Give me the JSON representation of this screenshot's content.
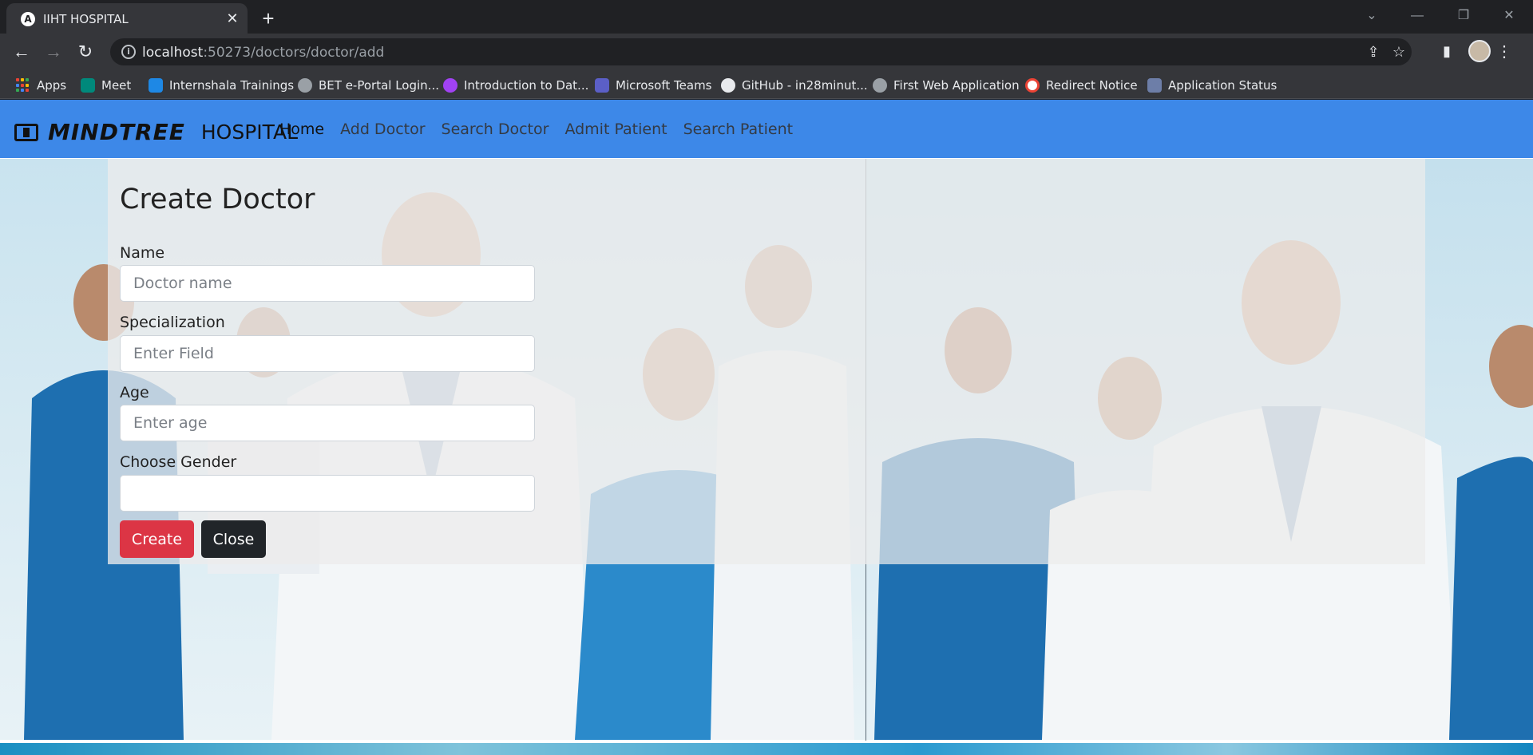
{
  "browser": {
    "tab_title": "IIHT HOSPITAL",
    "tab_favicon_letter": "A",
    "url_host": "localhost",
    "url_path": ":50273/doctors/doctor/add",
    "bookmarks": [
      {
        "label": "Apps",
        "color": "#4285f4"
      },
      {
        "label": "Meet",
        "color": "#00897b"
      },
      {
        "label": "Internshala Trainings",
        "color": "#1e88e5"
      },
      {
        "label": "BET e-Portal Login...",
        "color": "#9aa0a6"
      },
      {
        "label": "Introduction to Dat...",
        "color": "#a142f4"
      },
      {
        "label": "Microsoft Teams",
        "color": "#5b5fc7"
      },
      {
        "label": "GitHub - in28minut...",
        "color": "#e8eaed"
      },
      {
        "label": "First Web Application",
        "color": "#9aa0a6"
      },
      {
        "label": "Redirect Notice",
        "color": "#ea4335"
      },
      {
        "label": "Application Status",
        "color": "#6d7ea8"
      }
    ]
  },
  "navbar": {
    "brand_name": "MINDTREE",
    "brand_suffix": "HOSPITAL",
    "links": [
      "Home",
      "Add Doctor",
      "Search Doctor",
      "Admit Patient",
      "Search Patient"
    ],
    "color": "#3d88e8"
  },
  "form": {
    "title": "Create Doctor",
    "name_label": "Name",
    "name_placeholder": "Doctor name",
    "specialization_label": "Specialization",
    "specialization_placeholder": "Enter Field",
    "age_label": "Age",
    "age_placeholder": "Enter age",
    "gender_label": "Choose Gender",
    "gender_value": "",
    "create_label": "Create",
    "close_label": "Close",
    "create_color": "#dc3545",
    "close_color": "#212529"
  }
}
